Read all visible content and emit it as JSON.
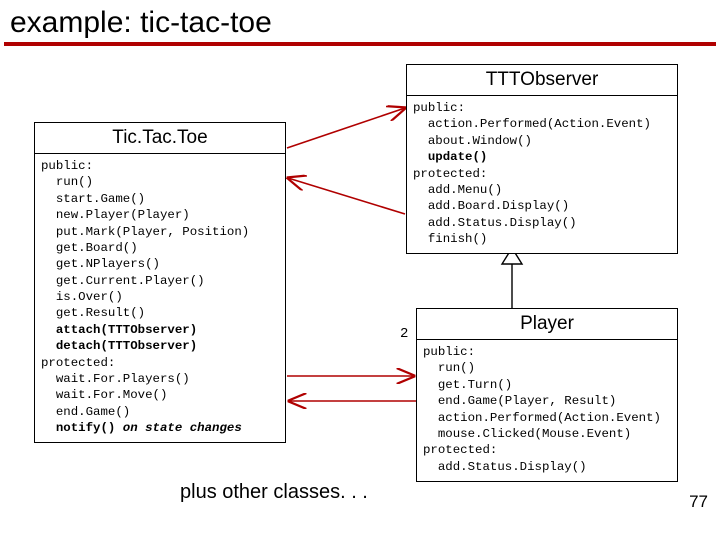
{
  "title": "example: tic-tac-toe",
  "caption": "plus other classes. . .",
  "page_number": "77",
  "multiplicity_player": "2",
  "classes": {
    "tictactoe": {
      "name": "Tic.Tac.Toe",
      "vis0": "public:",
      "m0": "  run()",
      "m1": "  start.Game()",
      "m2": "  new.Player(Player)",
      "m3": "  put.Mark(Player, Position)",
      "m4": "  get.Board()",
      "m5": "  get.NPlayers()",
      "m6": "  get.Current.Player()",
      "m7": "  is.Over()",
      "m8": "  get.Result()",
      "m9a": "  attach(TTTObserver)",
      "m9b": "  detach(TTTObserver)",
      "vis1": "protected:",
      "m10": "  wait.For.Players()",
      "m11": "  wait.For.Move()",
      "m12": "  end.Game()",
      "m13a": "  notify()",
      "m13b": " on state changes"
    },
    "tttobserver": {
      "name": "TTTObserver",
      "vis0": "public:",
      "m0": "  action.Performed(Action.Event)",
      "m1": "  about.Window()",
      "m2": "  update()",
      "vis1": "protected:",
      "m3": "  add.Menu()",
      "m4": "  add.Board.Display()",
      "m5": "  add.Status.Display()",
      "m6": "  finish()"
    },
    "player": {
      "name": "Player",
      "vis0": "public:",
      "m0": "  run()",
      "m1": "  get.Turn()",
      "m2": "  end.Game(Player, Result)",
      "m3": "  action.Performed(Action.Event)",
      "m4": "  mouse.Clicked(Mouse.Event)",
      "vis1": "protected:",
      "m5": "  add.Status.Display()"
    }
  }
}
